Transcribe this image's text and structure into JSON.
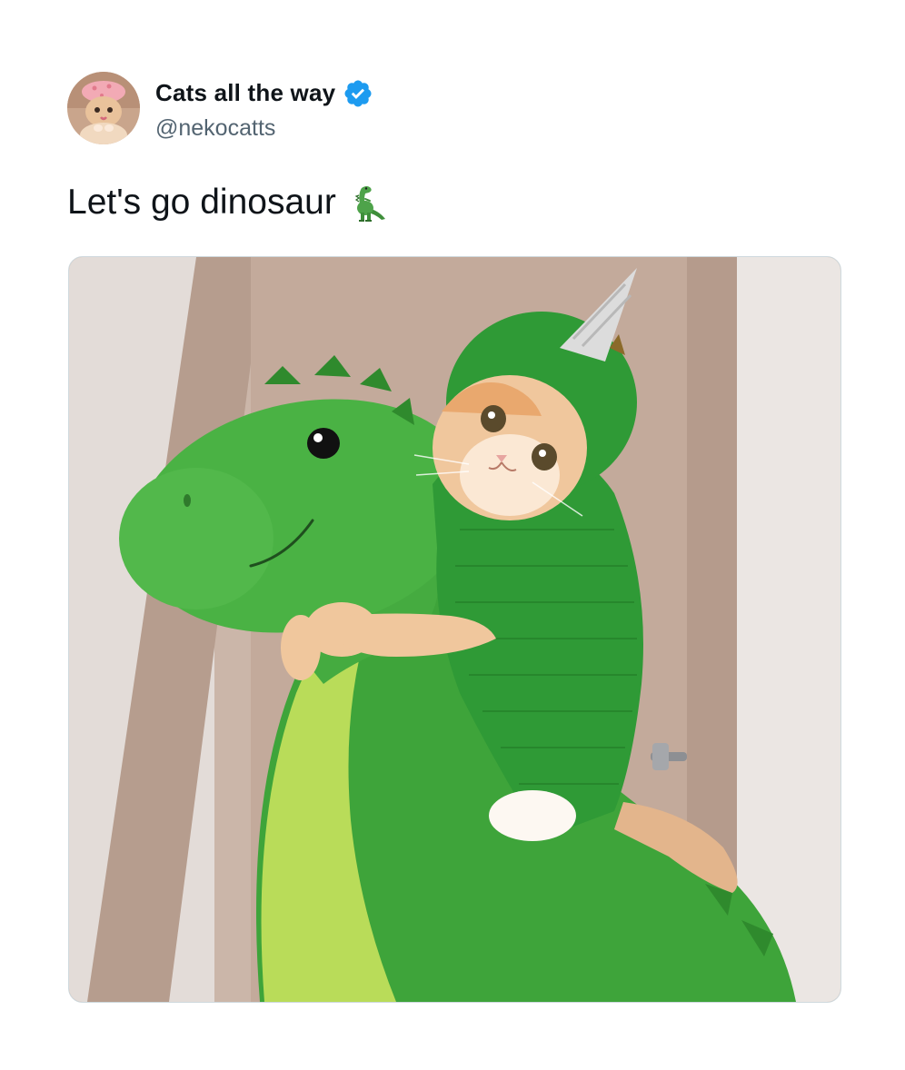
{
  "tweet": {
    "author": {
      "display_name": "Cats all the way",
      "handle": "@nekocatts",
      "verified": true
    },
    "text": "Let's go dinosaur",
    "emoji": "t-rex",
    "media": {
      "type": "photo"
    }
  },
  "colors": {
    "verified_badge": "#1d9bf0",
    "text_primary": "#0f1419",
    "text_secondary": "#536471",
    "media_border": "#cfd9de"
  },
  "icons": {
    "verified": "verified-badge-icon",
    "emoji": "t-rex-emoji-icon"
  }
}
